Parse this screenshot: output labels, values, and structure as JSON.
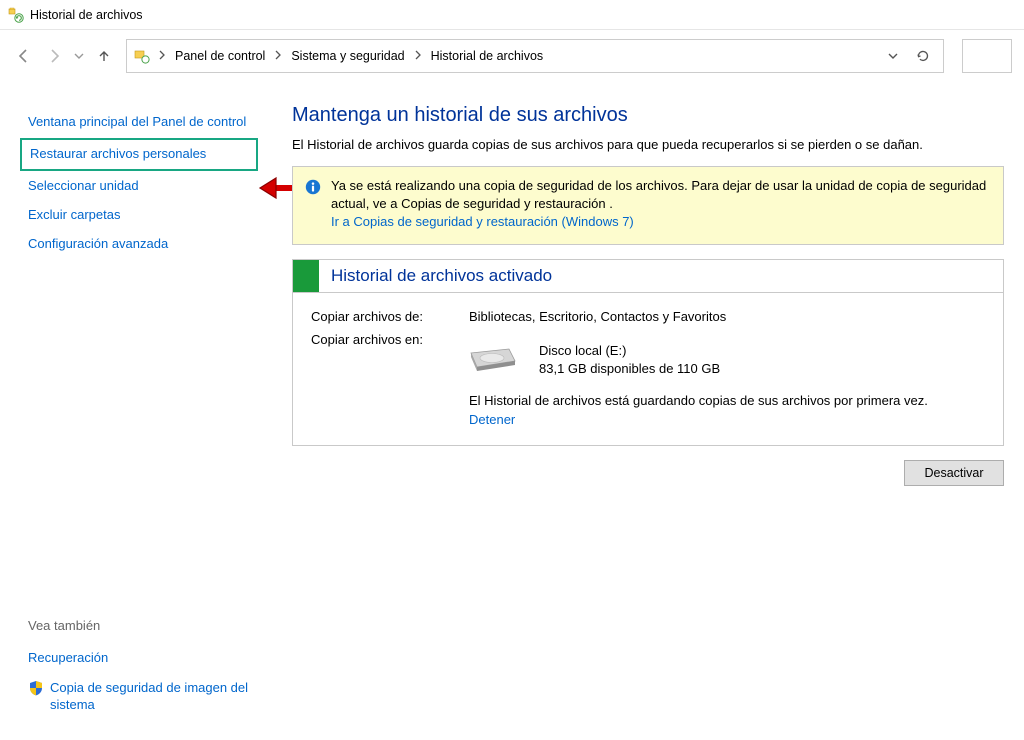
{
  "window": {
    "title": "Historial de archivos"
  },
  "breadcrumbs": {
    "item0": "Panel de control",
    "item1": "Sistema y seguridad",
    "item2": "Historial de archivos"
  },
  "sidebar": {
    "links": {
      "main_panel": "Ventana principal del Panel de control",
      "restore": "Restaurar archivos personales",
      "select_drive": "Seleccionar unidad",
      "exclude": "Excluir carpetas",
      "advanced": "Configuración avanzada"
    },
    "see_also_label": "Vea también",
    "secondary": {
      "recovery": "Recuperación",
      "system_image": "Copia de seguridad de imagen del sistema"
    }
  },
  "main": {
    "heading": "Mantenga un historial de sus archivos",
    "subtitle": "El Historial de archivos guarda copias de sus archivos para que pueda recuperarlos si se pierden o se dañan.",
    "banner": {
      "text": "Ya se está realizando una copia de seguridad de los archivos. Para dejar de usar la unidad de copia de seguridad actual, ve a Copias de seguridad y restauración .",
      "link": "Ir a Copias de seguridad y restauración (Windows 7)"
    },
    "status": {
      "title": "Historial de archivos activado",
      "from_label": "Copiar archivos de:",
      "from_value": "Bibliotecas, Escritorio, Contactos y Favoritos",
      "to_label": "Copiar archivos en:",
      "disk_name": "Disco local (E:)",
      "disk_space": "83,1 GB disponibles de 110 GB",
      "saving_text": "El Historial de archivos está guardando copias de sus archivos por primera vez.",
      "stop_link": "Detener"
    },
    "deactivate_button": "Desactivar"
  }
}
